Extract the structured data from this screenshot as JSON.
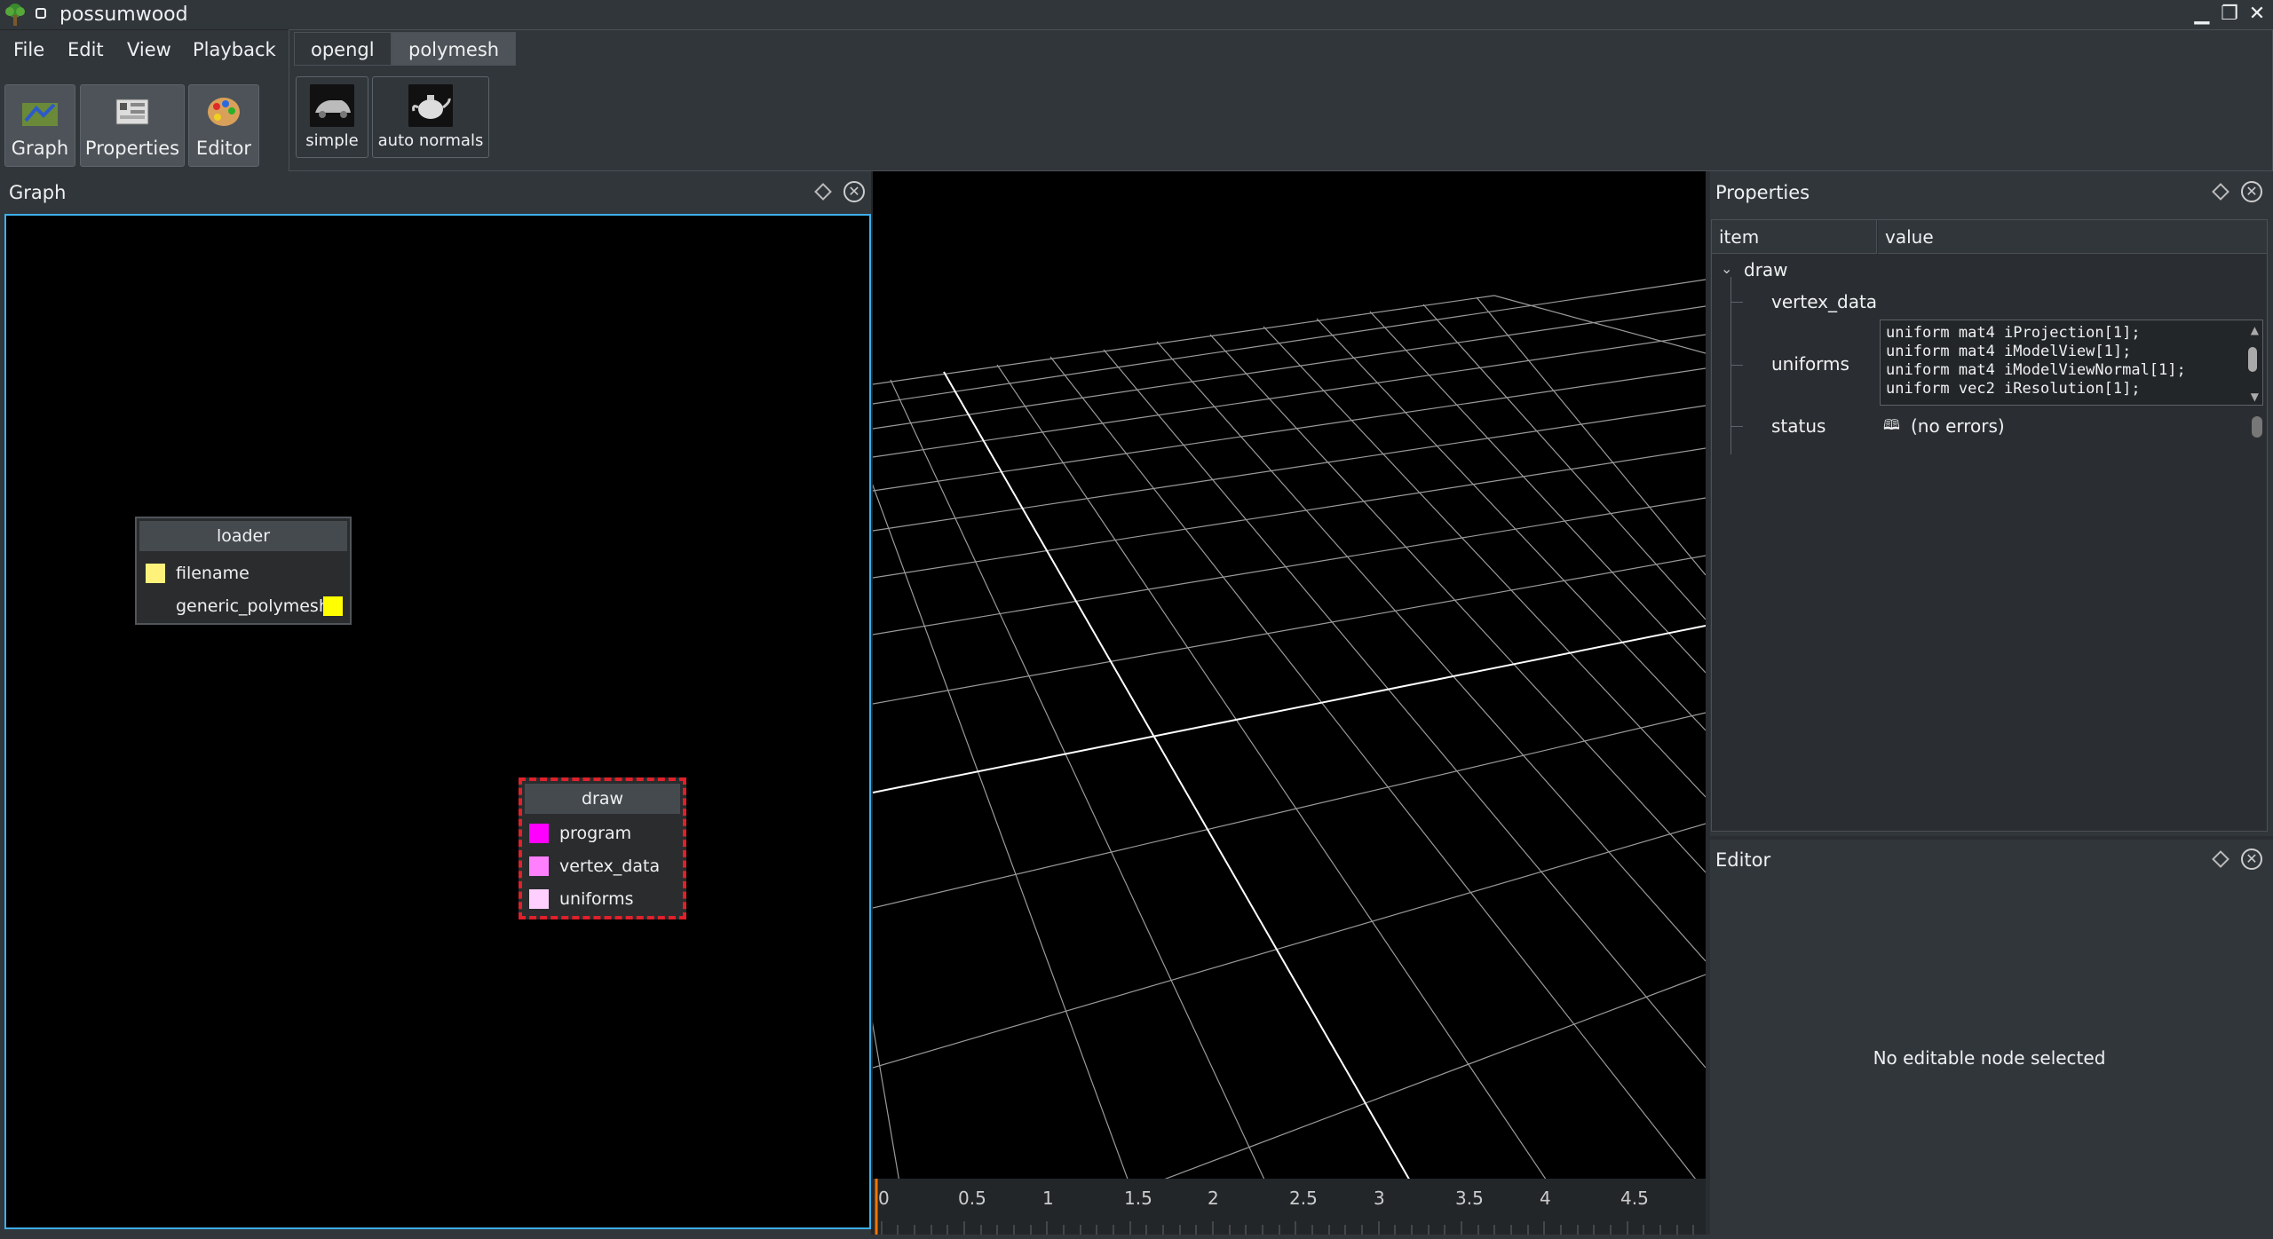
{
  "window": {
    "title": "possumwood",
    "controls": [
      "minimize-icon",
      "maximize-icon",
      "close-icon"
    ]
  },
  "menu": {
    "items": [
      "File",
      "Edit",
      "View",
      "Playback"
    ]
  },
  "toolbar": {
    "buttons": [
      {
        "label": "Graph",
        "icon": "graph-icon"
      },
      {
        "label": "Properties",
        "icon": "properties-icon"
      },
      {
        "label": "Editor",
        "icon": "editor-icon"
      }
    ]
  },
  "tabs": {
    "items": [
      "opengl",
      "polymesh"
    ],
    "active": "polymesh"
  },
  "shelf": {
    "buttons": [
      {
        "label": "simple",
        "icon": "car-icon"
      },
      {
        "label": "auto normals",
        "icon": "teapot-icon"
      }
    ]
  },
  "graph_panel": {
    "title": "Graph",
    "nodes": [
      {
        "title": "loader",
        "ports": [
          "filename",
          "generic_polymesh"
        ],
        "port_colors": [
          "#fff27a",
          "#ffff00"
        ]
      },
      {
        "title": "draw",
        "ports": [
          "program",
          "vertex_data",
          "uniforms"
        ],
        "port_colors": [
          "#ff00ff",
          "#ff80ff",
          "#ffd0ff"
        ],
        "selected": true
      }
    ]
  },
  "timeline": {
    "labels": [
      "0",
      "0.5",
      "1",
      "1.5",
      "2",
      "2.5",
      "3",
      "3.5",
      "4",
      "4.5"
    ],
    "cursor_color": "#f67400"
  },
  "properties_panel": {
    "title": "Properties",
    "columns": [
      "item",
      "value"
    ],
    "tree_root": "draw",
    "rows": [
      {
        "item": "vertex_data",
        "value": ""
      },
      {
        "item": "uniforms",
        "value": "uniform mat4 iProjection[1];\nuniform mat4 iModelView[1];\nuniform mat4 iModelViewNormal[1];\nuniform vec2 iResolution[1];"
      },
      {
        "item": "status",
        "value": "(no errors)"
      }
    ]
  },
  "editor_panel": {
    "title": "Editor",
    "message": "No editable node selected"
  },
  "colors": {
    "background": "#31363b",
    "accent": "#3daee9",
    "selected_node_border": "#e0202a"
  }
}
